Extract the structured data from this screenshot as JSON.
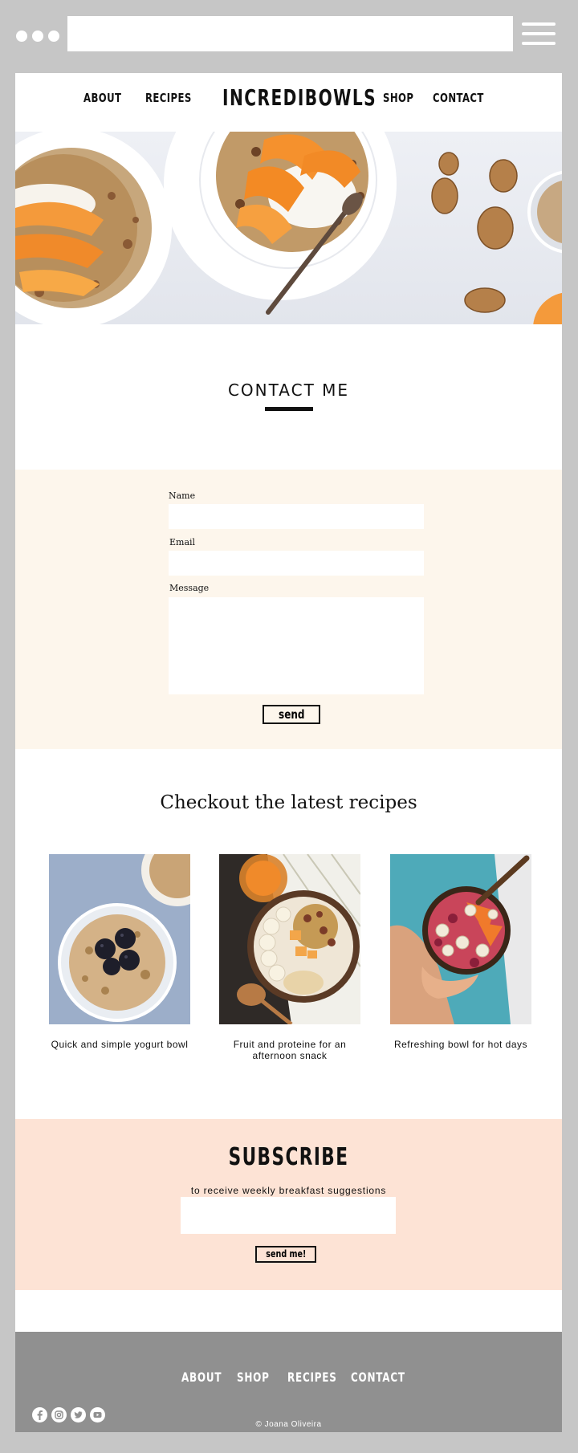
{
  "nav": {
    "about": "ABOUT",
    "recipes": "RECIPES",
    "brand": "INCREDIBOWLS",
    "shop": "SHOP",
    "contact": "CONTACT"
  },
  "hero": {
    "icon": "granola-bowls-photo"
  },
  "contact": {
    "title": "CONTACT ME",
    "name_label": "Name",
    "email_label": "Email",
    "message_label": "Message",
    "send_label": "send"
  },
  "latest": {
    "title": "Checkout the latest recipes",
    "recipes": [
      {
        "caption": "Quick and simple yogurt bowl",
        "icon": "yogurt-bowl-photo"
      },
      {
        "caption": "Fruit and proteine for an afternoon snack",
        "icon": "fruit-bowl-photo"
      },
      {
        "caption": "Refreshing bowl for hot days",
        "icon": "smoothie-bowl-photo"
      }
    ]
  },
  "subscribe": {
    "title": "SUBSCRIBE",
    "text": "to receive weekly breakfast suggestions",
    "button_label": "send me!"
  },
  "footer": {
    "links": [
      "ABOUT",
      "SHOP",
      "RECIPES",
      "CONTACT"
    ],
    "social_icons": [
      "facebook-icon",
      "instagram-icon",
      "twitter-icon",
      "youtube-icon"
    ],
    "copyright": "© Joana Oliveira"
  },
  "colors": {
    "frame": "#c6c6c6",
    "form_bg": "#fdf6ec",
    "subscribe_bg": "#fde3d5",
    "footer_bg": "#909090",
    "text": "#111111"
  }
}
